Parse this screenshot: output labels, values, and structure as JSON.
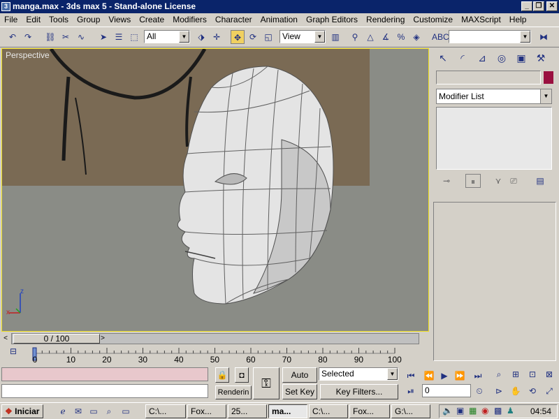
{
  "window": {
    "title": "manga.max - 3ds max 5 - Stand-alone License",
    "app_icon": "3ds-max-icon",
    "minimize_label": "_",
    "restore_label": "❐",
    "close_label": "✕"
  },
  "menu": [
    "File",
    "Edit",
    "Tools",
    "Group",
    "Views",
    "Create",
    "Modifiers",
    "Character",
    "Animation",
    "Graph Editors",
    "Rendering",
    "Customize",
    "MAXScript",
    "Help"
  ],
  "toolbar": {
    "selection_filter": "All",
    "reference_coord": "View",
    "named_selection": ""
  },
  "viewport": {
    "label": "Perspective",
    "axis_z": "z",
    "axis_x": "x"
  },
  "command_panel": {
    "object_color": "#9a1040",
    "modifier_list": "Modifier List"
  },
  "timeslider": {
    "position": "0 / 100",
    "prev_label": "<",
    "next_label": ">"
  },
  "trackbar": {
    "ticks": [
      "0",
      "10",
      "20",
      "30",
      "40",
      "50",
      "60",
      "70",
      "80",
      "90",
      "100"
    ]
  },
  "status": {
    "rendering_label": "Renderin",
    "auto_key": "Auto Key",
    "set_key": "Set Key",
    "selected": "Selected",
    "key_filters": "Key Filters...",
    "frame": "0"
  },
  "taskbar": {
    "start": "Iniciar",
    "tasks": [
      "C:\\...",
      "Fox...",
      "25...",
      "ma...",
      "C:\\...",
      "Fox...",
      "G:\\..."
    ],
    "clock": "04:54"
  }
}
